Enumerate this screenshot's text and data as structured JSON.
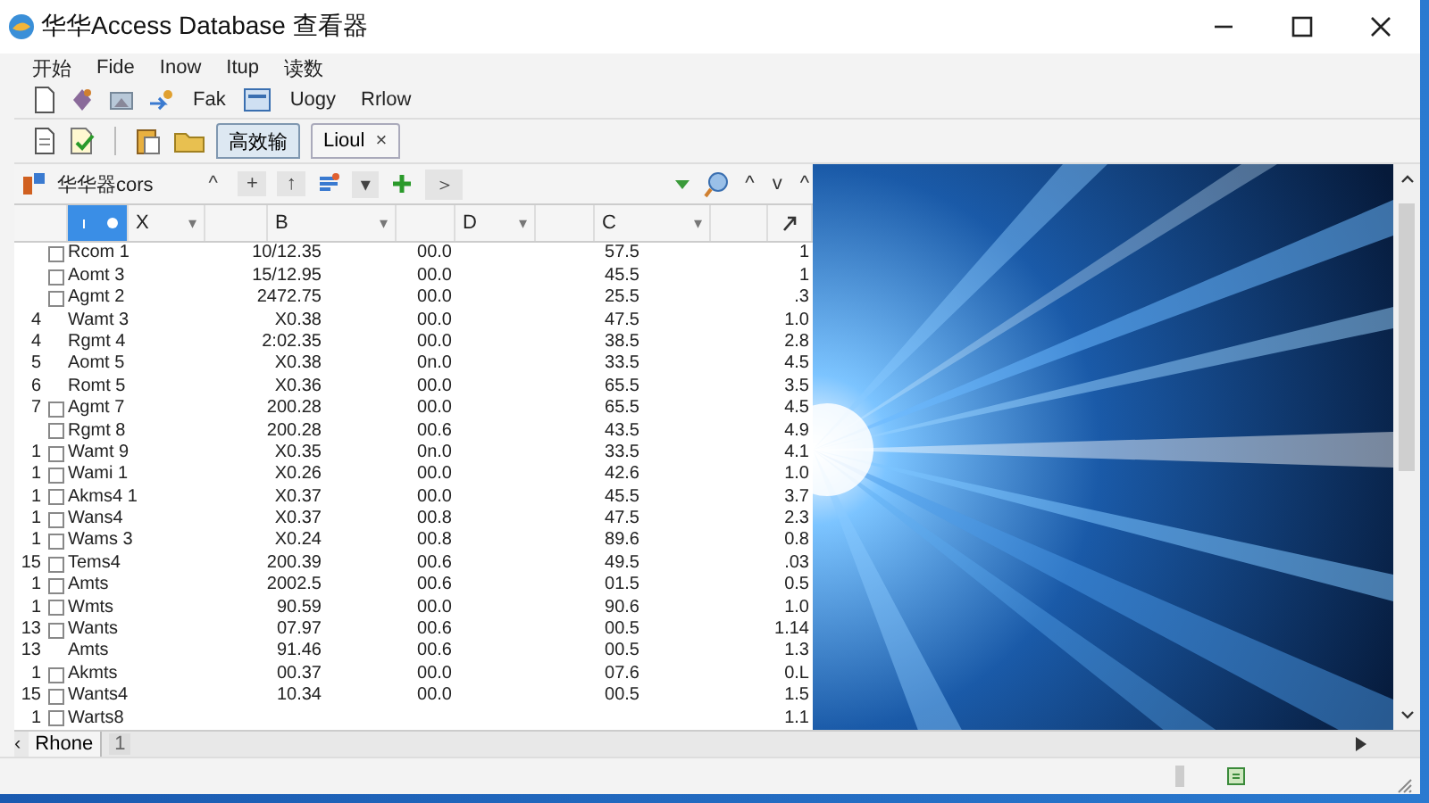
{
  "window": {
    "title": "华华Access Database 查看器"
  },
  "menu": [
    "开始",
    "Fide",
    "Inow",
    "Itup",
    "读数"
  ],
  "toolbar": {
    "labels": [
      "Fak",
      "Uogy",
      "Rrlow"
    ]
  },
  "tabs": [
    {
      "label": "高效输",
      "selected": true,
      "closable": false
    },
    {
      "label": "Lioul",
      "selected": false,
      "closable": true,
      "close": "×"
    }
  ],
  "panel": {
    "title": "华华器cors",
    "buttons": [
      "^",
      "+",
      "↑",
      "▾",
      "＞"
    ],
    "nav": [
      "^",
      "v",
      "^"
    ]
  },
  "table": {
    "columns": [
      {
        "label": "X",
        "filter": "▾"
      },
      {
        "label": "B",
        "filter": "▾"
      },
      {
        "label": "D",
        "filter": "▾"
      },
      {
        "label": "C",
        "filter": "▾"
      }
    ],
    "rows": [
      {
        "num": "",
        "checked": false,
        "name": "Rcom 1",
        "v1": "10/12.35",
        "v2": "00.0",
        "v3": "57.5",
        "last": "1"
      },
      {
        "num": "",
        "checked": false,
        "name": "Aomt 3",
        "v1": "15/12.95",
        "v2": "00.0",
        "v3": "45.5",
        "last": "1"
      },
      {
        "num": "",
        "checked": false,
        "name": "Agmt 2",
        "v1": "2472.75",
        "v2": "00.0",
        "v3": "25.5",
        "last": ".3"
      },
      {
        "num": "4",
        "name": "Wamt 3",
        "v1": "X0.38",
        "v2": "00.0",
        "v3": "47.5",
        "last": "1.0"
      },
      {
        "num": "4",
        "name": "Rgmt 4",
        "v1": "2:02.35",
        "v2": "00.0",
        "v3": "38.5",
        "last": "2.8"
      },
      {
        "num": "5",
        "name": "Aomt 5",
        "v1": "X0.38",
        "v2": "0n.0",
        "v3": "33.5",
        "last": "4.5"
      },
      {
        "num": "6",
        "name": "Romt 5",
        "v1": "X0.36",
        "v2": "00.0",
        "v3": "65.5",
        "last": "3.5"
      },
      {
        "num": "7",
        "checked": false,
        "name": "Agmt 7",
        "v1": "200.28",
        "v2": "00.0",
        "v3": "65.5",
        "last": "4.5"
      },
      {
        "num": "",
        "checked": false,
        "name": "Rgmt 8",
        "v1": "200.28",
        "v2": "00.6",
        "v3": "43.5",
        "last": "4.9"
      },
      {
        "num": "1",
        "checked": false,
        "name": "Wamt 9",
        "v1": "X0.35",
        "v2": "0n.0",
        "v3": "33.5",
        "last": "4.1"
      },
      {
        "num": "1",
        "checked": false,
        "name": "Wami 1",
        "v1": "X0.26",
        "v2": "00.0",
        "v3": "42.6",
        "last": "1.0"
      },
      {
        "num": "1",
        "checked": false,
        "name": "Akms4 1",
        "v1": "X0.37",
        "v2": "00.0",
        "v3": "45.5",
        "last": "3.7"
      },
      {
        "num": "1",
        "checked": false,
        "name": "Wans4",
        "v1": "X0.37",
        "v2": "00.8",
        "v3": "47.5",
        "last": "2.3"
      },
      {
        "num": "1",
        "checked": false,
        "name": "Wams 3",
        "v1": "X0.24",
        "v2": "00.8",
        "v3": "89.6",
        "last": "0.8"
      },
      {
        "num": "15",
        "checked": false,
        "name": "Tems4",
        "v1": "200.39",
        "v2": "00.6",
        "v3": "49.5",
        "last": ".03"
      },
      {
        "num": "1",
        "checked": false,
        "name": "Amts",
        "v1": "2002.5",
        "v2": "00.6",
        "v3": "01.5",
        "last": "0.5"
      },
      {
        "num": "1",
        "checked": false,
        "name": "Wmts",
        "v1": "90.59",
        "v2": "00.0",
        "v3": "90.6",
        "last": "1.0"
      },
      {
        "num": "13",
        "checked": false,
        "name": "Wants",
        "v1": "07.97",
        "v2": "00.6",
        "v3": "00.5",
        "last": "1.14"
      },
      {
        "num": "13",
        "name": "Amts",
        "v1": "91.46",
        "v2": "00.6",
        "v3": "00.5",
        "last": "1.3"
      },
      {
        "num": "1",
        "checked": false,
        "name": "Akmts",
        "v1": "00.37",
        "v2": "00.0",
        "v3": "07.6",
        "last": "0.L"
      },
      {
        "num": "15",
        "checked": false,
        "name": "Wants4",
        "v1": "10.34",
        "v2": "00.0",
        "v3": "00.5",
        "last": "1.5"
      },
      {
        "num": "1",
        "checked": false,
        "name": "Warts8",
        "v1": "",
        "v2": "",
        "v3": "",
        "last": "1.1"
      }
    ]
  },
  "sheet_tab": {
    "label": "Rhone",
    "prev": "‹",
    "page": "1"
  }
}
